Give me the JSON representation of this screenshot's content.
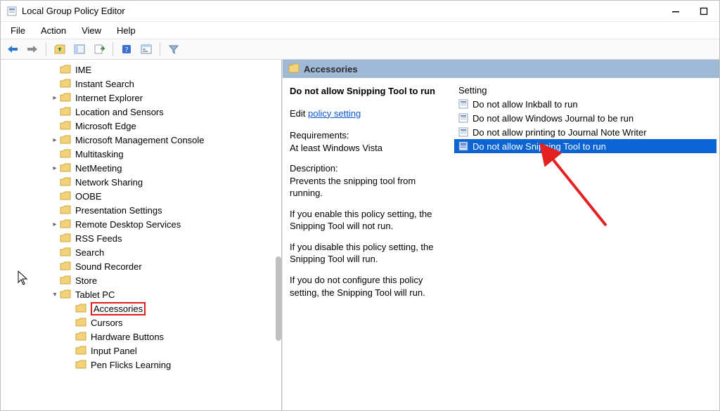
{
  "window": {
    "title": "Local Group Policy Editor"
  },
  "menu": {
    "file": "File",
    "action": "Action",
    "view": "View",
    "help": "Help"
  },
  "tree": [
    {
      "indent": 0,
      "caret": "",
      "label": "IME"
    },
    {
      "indent": 0,
      "caret": "",
      "label": "Instant Search"
    },
    {
      "indent": 0,
      "caret": ">",
      "label": "Internet Explorer"
    },
    {
      "indent": 0,
      "caret": "",
      "label": "Location and Sensors"
    },
    {
      "indent": 0,
      "caret": "",
      "label": "Microsoft Edge"
    },
    {
      "indent": 0,
      "caret": ">",
      "label": "Microsoft Management Console"
    },
    {
      "indent": 0,
      "caret": "",
      "label": "Multitasking"
    },
    {
      "indent": 0,
      "caret": ">",
      "label": "NetMeeting"
    },
    {
      "indent": 0,
      "caret": "",
      "label": "Network Sharing"
    },
    {
      "indent": 0,
      "caret": "",
      "label": "OOBE"
    },
    {
      "indent": 0,
      "caret": "",
      "label": "Presentation Settings"
    },
    {
      "indent": 0,
      "caret": ">",
      "label": "Remote Desktop Services"
    },
    {
      "indent": 0,
      "caret": "",
      "label": "RSS Feeds"
    },
    {
      "indent": 0,
      "caret": "",
      "label": "Search"
    },
    {
      "indent": 0,
      "caret": "",
      "label": "Sound Recorder"
    },
    {
      "indent": 0,
      "caret": "",
      "label": "Store"
    },
    {
      "indent": 0,
      "caret": "v",
      "label": "Tablet PC"
    },
    {
      "indent": 1,
      "caret": "",
      "label": "Accessories",
      "highlight": true
    },
    {
      "indent": 1,
      "caret": "",
      "label": "Cursors"
    },
    {
      "indent": 1,
      "caret": "",
      "label": "Hardware Buttons"
    },
    {
      "indent": 1,
      "caret": "",
      "label": "Input Panel"
    },
    {
      "indent": 1,
      "caret": "",
      "label": "Pen Flicks Learning"
    }
  ],
  "right": {
    "heading": "Accessories",
    "policy_name": "Do not allow Snipping Tool to run",
    "edit_prefix": "Edit",
    "edit_link": "policy setting",
    "requirements_label": "Requirements:",
    "requirements_value": "At least Windows Vista",
    "description_label": "Description:",
    "description_value": "Prevents the snipping tool from running.",
    "para1": "If you enable this policy setting, the Snipping Tool will not run.",
    "para2": "If you disable this policy setting, the Snipping Tool will run.",
    "para3": "If you do not configure this policy setting, the Snipping Tool will run."
  },
  "list": {
    "header": "Setting",
    "items": [
      {
        "label": "Do not allow Inkball to run",
        "selected": false
      },
      {
        "label": "Do not allow Windows Journal to be run",
        "selected": false
      },
      {
        "label": "Do not allow printing to Journal Note Writer",
        "selected": false
      },
      {
        "label": "Do not allow Snipping Tool to run",
        "selected": true
      }
    ]
  }
}
